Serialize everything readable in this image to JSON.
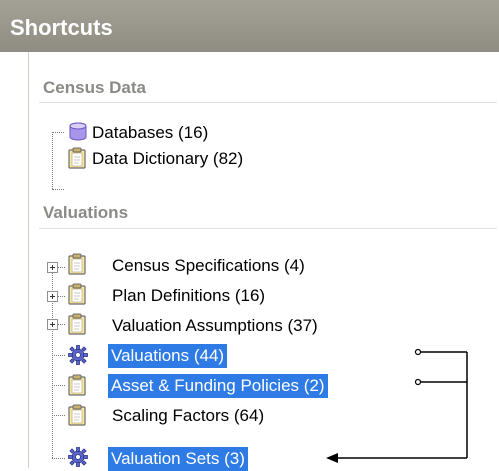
{
  "header": {
    "title": "Shortcuts"
  },
  "census": {
    "heading": "Census Data",
    "items": [
      {
        "label": "Databases (16)",
        "icon": "database-icon"
      },
      {
        "label": "Data Dictionary (82)",
        "icon": "clipboard-icon"
      }
    ]
  },
  "valuations": {
    "heading": "Valuations",
    "items": [
      {
        "label": "Census Specifications (4)",
        "icon": "clipboard-icon",
        "expandable": true,
        "selected": false
      },
      {
        "label": "Plan Definitions (16)",
        "icon": "clipboard-icon",
        "expandable": true,
        "selected": false
      },
      {
        "label": "Valuation Assumptions (37)",
        "icon": "clipboard-icon",
        "expandable": true,
        "selected": false
      },
      {
        "label": "Valuations (44)",
        "icon": "gear-icon",
        "expandable": false,
        "selected": true
      },
      {
        "label": "Asset & Funding Policies (2)",
        "icon": "clipboard-icon",
        "expandable": false,
        "selected": true
      },
      {
        "label": "Scaling Factors (64)",
        "icon": "clipboard-icon",
        "expandable": false,
        "selected": false
      },
      {
        "label": "Valuation Sets (3)",
        "icon": "gear-icon",
        "expandable": false,
        "selected": true
      }
    ]
  },
  "colors": {
    "header_bg": "#9a988d",
    "selection": "#2f7be6",
    "section_heading": "#8a8a86"
  }
}
